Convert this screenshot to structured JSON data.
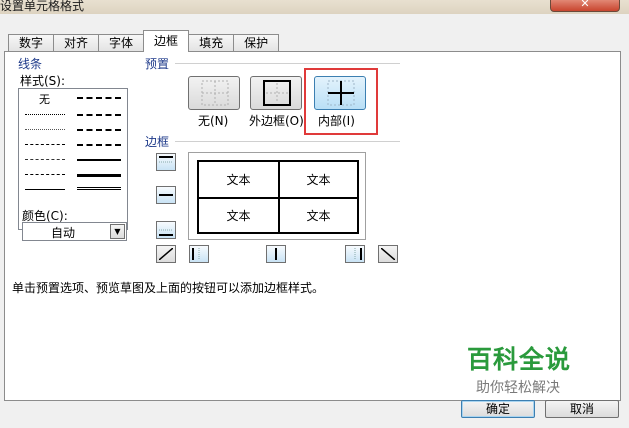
{
  "window": {
    "title": "设置单元格格式",
    "close_label": "✕"
  },
  "tabs": [
    {
      "label": "数字",
      "active": false
    },
    {
      "label": "对齐",
      "active": false
    },
    {
      "label": "字体",
      "active": false
    },
    {
      "label": "边框",
      "active": true
    },
    {
      "label": "填充",
      "active": false
    },
    {
      "label": "保护",
      "active": false
    }
  ],
  "line_group": {
    "title": "线条",
    "style_label": "样式(S):",
    "none_label": "无",
    "color_label": "颜色(C):",
    "color_value": "自动"
  },
  "presets": {
    "title": "预置",
    "items": [
      {
        "label": "无(N)",
        "selected": false
      },
      {
        "label": "外边框(O)",
        "selected": false
      },
      {
        "label": "内部(I)",
        "selected": true
      }
    ]
  },
  "border": {
    "title": "边框",
    "preview_cells": [
      "文本",
      "文本",
      "文本",
      "文本"
    ]
  },
  "hint": "单击预置选项、预览草图及上面的按钮可以添加边框样式。",
  "watermark": {
    "title": "百科全说",
    "subtitle": "助你轻松解决"
  },
  "buttons": {
    "ok": "确定",
    "cancel": "取消"
  },
  "colors": {
    "accent": "#3c7fb1",
    "highlight": "#e03a3a",
    "watermark": "#2a9a3c"
  }
}
